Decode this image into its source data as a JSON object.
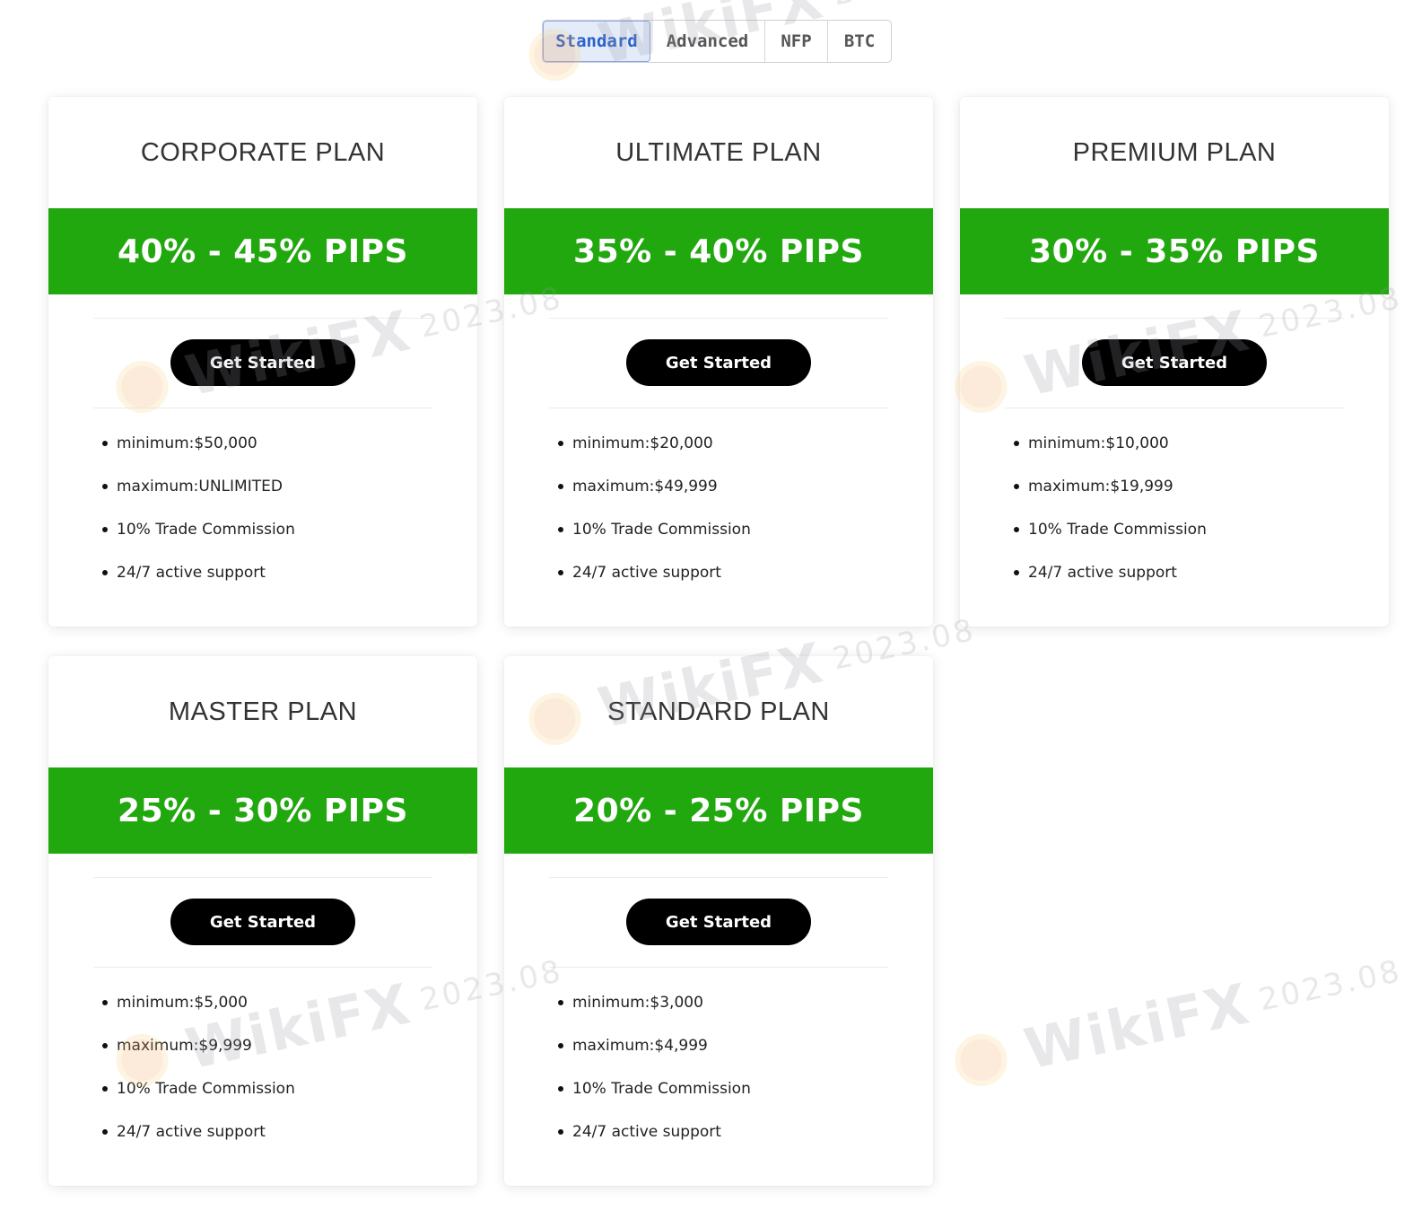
{
  "tabs": [
    {
      "label": "Standard",
      "active": true
    },
    {
      "label": "Advanced",
      "active": false
    },
    {
      "label": "NFP",
      "active": false
    },
    {
      "label": "BTC",
      "active": false
    }
  ],
  "plans": [
    {
      "title": "CORPORATE PLAN",
      "pips": "40% - 45% PIPS",
      "button_label": "Get Started",
      "features": [
        "minimum:$50,000",
        "maximum:UNLIMITED",
        "10% Trade Commission",
        "24/7 active support"
      ]
    },
    {
      "title": "ULTIMATE PLAN",
      "pips": "35% - 40% PIPS",
      "button_label": "Get Started",
      "features": [
        "minimum:$20,000",
        "maximum:$49,999",
        "10% Trade Commission",
        "24/7 active support"
      ]
    },
    {
      "title": "PREMIUM PLAN",
      "pips": "30% - 35% PIPS",
      "button_label": "Get Started",
      "features": [
        "minimum:$10,000",
        "maximum:$19,999",
        "10% Trade Commission",
        "24/7 active support"
      ]
    },
    {
      "title": "MASTER PLAN",
      "pips": "25% - 30% PIPS",
      "button_label": "Get Started",
      "features": [
        "minimum:$5,000",
        "maximum:$9,999",
        "10% Trade Commission",
        "24/7 active support"
      ]
    },
    {
      "title": "STANDARD PLAN",
      "pips": "20% - 25% PIPS",
      "button_label": "Get Started",
      "features": [
        "minimum:$3,000",
        "maximum:$4,999",
        "10% Trade Commission",
        "24/7 active support"
      ]
    }
  ],
  "watermark": {
    "brand": "WikiFX",
    "year": "2023.08"
  },
  "colors": {
    "pips_band": "#22a80f",
    "button": "#000000",
    "active_tab_text": "#2a62c9",
    "active_tab_bg": "#e4ecfa"
  }
}
